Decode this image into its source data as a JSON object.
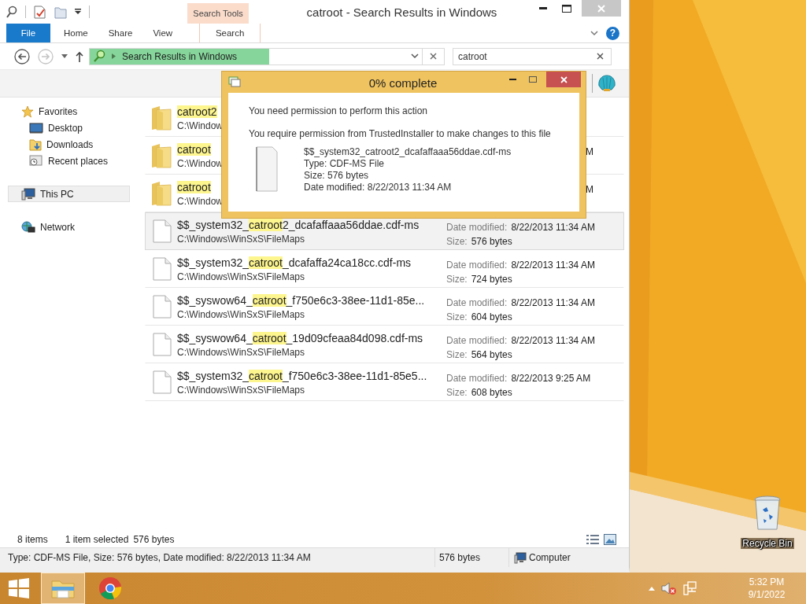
{
  "window": {
    "title": "catroot - Search Results in Windows",
    "contextual_tab_group": "Search Tools",
    "help_glyph": "?"
  },
  "ribbon_tabs": [
    {
      "label": "File",
      "kind": "file"
    },
    {
      "label": "Home",
      "kind": "normal"
    },
    {
      "label": "Share",
      "kind": "normal"
    },
    {
      "label": "View",
      "kind": "normal"
    },
    {
      "label": "Search",
      "kind": "contextual"
    }
  ],
  "address": {
    "location": "Search Results in Windows",
    "level": 0.54
  },
  "search": {
    "value": "catroot"
  },
  "navigation": [
    {
      "label": "Favorites",
      "kind": "star",
      "selected": false,
      "children": [
        {
          "label": "Desktop",
          "kind": "desktop",
          "selected": false
        },
        {
          "label": "Downloads",
          "kind": "downloads",
          "selected": false
        },
        {
          "label": "Recent places",
          "kind": "recent",
          "selected": false
        }
      ]
    },
    {
      "label": "This PC",
      "kind": "pc",
      "selected": true
    },
    {
      "label": "Network",
      "kind": "network",
      "selected": false
    }
  ],
  "items": [
    {
      "kind": "folder",
      "selected": false,
      "name": [
        {
          "text": "catroot2",
          "highlight": true
        }
      ],
      "path": "C:\\Window"
    },
    {
      "kind": "folder",
      "selected": false,
      "name": [
        {
          "text": "catroot",
          "highlight": true
        }
      ],
      "path": "C:\\Window",
      "tail": "M"
    },
    {
      "kind": "folder",
      "selected": false,
      "name": [
        {
          "text": "catroot",
          "highlight": true
        }
      ],
      "path": "C:\\Window",
      "tail": "M"
    },
    {
      "kind": "file",
      "selected": true,
      "name": [
        {
          "text": "$$_system32_",
          "highlight": false
        },
        {
          "text": "catroot",
          "highlight": true
        },
        {
          "text": "2_dcafaffaaa56ddae.cdf-ms",
          "highlight": false
        }
      ],
      "path": "C:\\Windows\\WinSxS\\FileMaps",
      "date_label": "Date modified:",
      "date": "8/22/2013 11:34 AM",
      "size_label": "Size:",
      "size": "576 bytes"
    },
    {
      "kind": "file",
      "selected": false,
      "name": [
        {
          "text": "$$_system32_",
          "highlight": false
        },
        {
          "text": "catroot",
          "highlight": true
        },
        {
          "text": "_dcafaffa24ca18cc.cdf-ms",
          "highlight": false
        }
      ],
      "path": "C:\\Windows\\WinSxS\\FileMaps",
      "date_label": "Date modified:",
      "date": "8/22/2013 11:34 AM",
      "size_label": "Size:",
      "size": "724 bytes"
    },
    {
      "kind": "file",
      "selected": false,
      "name": [
        {
          "text": "$$_syswow64_",
          "highlight": false
        },
        {
          "text": "catroot",
          "highlight": true
        },
        {
          "text": "_f750e6c3-38ee-11d1-85e...",
          "highlight": false
        }
      ],
      "path": "C:\\Windows\\WinSxS\\FileMaps",
      "date_label": "Date modified:",
      "date": "8/22/2013 11:34 AM",
      "size_label": "Size:",
      "size": "604 bytes"
    },
    {
      "kind": "file",
      "selected": false,
      "name": [
        {
          "text": "$$_syswow64_",
          "highlight": false
        },
        {
          "text": "catroot",
          "highlight": true
        },
        {
          "text": "_19d09cfeaa84d098.cdf-ms",
          "highlight": false
        }
      ],
      "path": "C:\\Windows\\WinSxS\\FileMaps",
      "date_label": "Date modified:",
      "date": "8/22/2013 11:34 AM",
      "size_label": "Size:",
      "size": "564 bytes"
    },
    {
      "kind": "file",
      "selected": false,
      "name": [
        {
          "text": "$$_system32_",
          "highlight": false
        },
        {
          "text": "catroot",
          "highlight": true
        },
        {
          "text": "_f750e6c3-38ee-11d1-85e5...",
          "highlight": false
        }
      ],
      "path": "C:\\Windows\\WinSxS\\FileMaps",
      "date_label": "Date modified:",
      "date": "8/22/2013 9:25 AM",
      "size_label": "Size:",
      "size": "608 bytes"
    }
  ],
  "status_bar": {
    "item_count": "8 items",
    "selection": "1 item selected",
    "selection_size": "576 bytes"
  },
  "details_bar": {
    "description": "Type: CDF-MS File, Size: 576 bytes, Date modified: 8/22/2013 11:34 AM",
    "size": "576 bytes",
    "zone": "Computer"
  },
  "dialog": {
    "title": "0% complete",
    "heading": "You need permission to perform this action",
    "message": "You require permission from TrustedInstaller to make changes to this file",
    "file": {
      "name": "$$_system32_catroot2_dcafaffaaa56ddae.cdf-ms",
      "type": "Type: CDF-MS File",
      "size": "Size: 576 bytes",
      "modified": "Date modified: 8/22/2013 11:34 AM"
    }
  },
  "desktop_icons": [
    {
      "label": "Recycle Bin"
    }
  ],
  "taskbar": {
    "apps": [
      {
        "kind": "explorer",
        "selected": true
      },
      {
        "kind": "browser",
        "selected": false
      }
    ],
    "volume_muted": true,
    "clock": {
      "time": "5:32 PM",
      "date": "9/1/2022"
    }
  }
}
